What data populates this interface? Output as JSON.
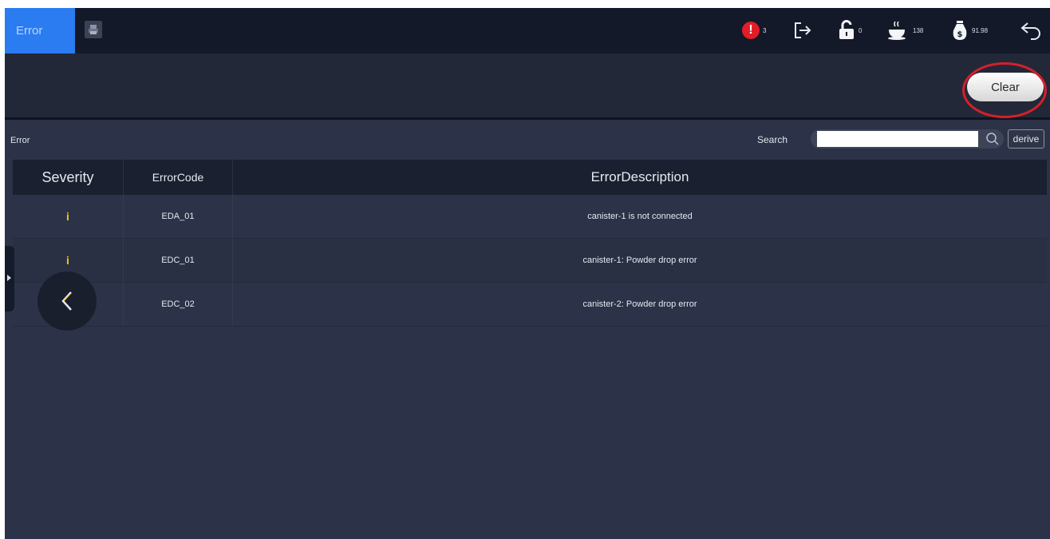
{
  "topbar": {
    "tab_label": "Error",
    "status": {
      "alert_count": "3",
      "lock_value": "0",
      "cup_value": "138",
      "money_value": "91.98"
    }
  },
  "toolbar": {
    "clear_label": "Clear"
  },
  "section": {
    "title": "Error",
    "search_label": "Search",
    "search_value": "",
    "derive_label": "derive"
  },
  "table": {
    "headers": [
      "Severity",
      "ErrorCode",
      "ErrorDescription"
    ],
    "rows": [
      {
        "severity": "i",
        "code": "EDA_01",
        "description": "canister-1 is not connected"
      },
      {
        "severity": "i",
        "code": "EDC_01",
        "description": "canister-1: Powder drop error"
      },
      {
        "severity": "",
        "code": "EDC_02",
        "description": "canister-2: Powder drop error"
      }
    ]
  },
  "colors": {
    "accent": "#2a7cf0",
    "alert": "#e31d28",
    "warning": "#f0c419",
    "highlight": "#d4202a"
  }
}
